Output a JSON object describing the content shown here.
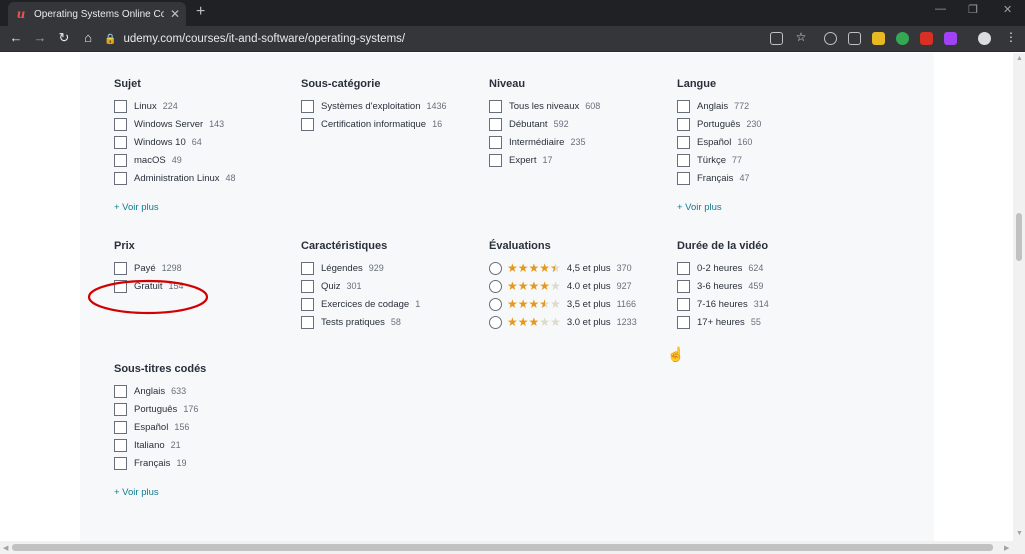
{
  "browser": {
    "tab_title": "Operating Systems Online Courses",
    "tab_close": "✕",
    "new_tab": "+",
    "url": "udemy.com/courses/it-and-software/operating-systems/"
  },
  "colors": {
    "accent_link": "#0f7c90",
    "star": "#e59819",
    "annotation_circle": "#d20000"
  },
  "filters": {
    "sujet": {
      "title": "Sujet",
      "options": [
        {
          "label": "Linux",
          "count": "224"
        },
        {
          "label": "Windows Server",
          "count": "143"
        },
        {
          "label": "Windows 10",
          "count": "64"
        },
        {
          "label": "macOS",
          "count": "49"
        },
        {
          "label": "Administration Linux",
          "count": "48"
        }
      ],
      "more": "+ Voir plus"
    },
    "souscategorie": {
      "title": "Sous-catégorie",
      "options": [
        {
          "label": "Systèmes d'exploitation",
          "count": "1436"
        },
        {
          "label": "Certification informatique",
          "count": "16"
        }
      ]
    },
    "niveau": {
      "title": "Niveau",
      "options": [
        {
          "label": "Tous les niveaux",
          "count": "608"
        },
        {
          "label": "Débutant",
          "count": "592"
        },
        {
          "label": "Intermédiaire",
          "count": "235"
        },
        {
          "label": "Expert",
          "count": "17"
        }
      ]
    },
    "langue": {
      "title": "Langue",
      "options": [
        {
          "label": "Anglais",
          "count": "772"
        },
        {
          "label": "Português",
          "count": "230"
        },
        {
          "label": "Español",
          "count": "160"
        },
        {
          "label": "Türkçe",
          "count": "77"
        },
        {
          "label": "Français",
          "count": "47"
        }
      ],
      "more": "+ Voir plus"
    },
    "prix": {
      "title": "Prix",
      "options": [
        {
          "label": "Payé",
          "count": "1298"
        },
        {
          "label": "Gratuit",
          "count": "154"
        }
      ]
    },
    "caracteristiques": {
      "title": "Caractéristiques",
      "options": [
        {
          "label": "Légendes",
          "count": "929"
        },
        {
          "label": "Quiz",
          "count": "301"
        },
        {
          "label": "Exercices de codage",
          "count": "1"
        },
        {
          "label": "Tests pratiques",
          "count": "58"
        }
      ]
    },
    "evaluations": {
      "title": "Évaluations",
      "options": [
        {
          "label": "4,5 et plus",
          "count": "370",
          "rating": 4.5
        },
        {
          "label": "4.0 et plus",
          "count": "927",
          "rating": 4.0
        },
        {
          "label": "3,5 et plus",
          "count": "1166",
          "rating": 3.5
        },
        {
          "label": "3.0 et plus",
          "count": "1233",
          "rating": 3.0
        }
      ]
    },
    "duree": {
      "title": "Durée de la vidéo",
      "options": [
        {
          "label": "0-2 heures",
          "count": "624"
        },
        {
          "label": "3-6 heures",
          "count": "459"
        },
        {
          "label": "7-16 heures",
          "count": "314"
        },
        {
          "label": "17+ heures",
          "count": "55"
        }
      ]
    },
    "soustitres": {
      "title": "Sous-titres codés",
      "options": [
        {
          "label": "Anglais",
          "count": "633"
        },
        {
          "label": "Português",
          "count": "176"
        },
        {
          "label": "Español",
          "count": "156"
        },
        {
          "label": "Italiano",
          "count": "21"
        },
        {
          "label": "Français",
          "count": "19"
        }
      ],
      "more": "+ Voir plus"
    }
  }
}
